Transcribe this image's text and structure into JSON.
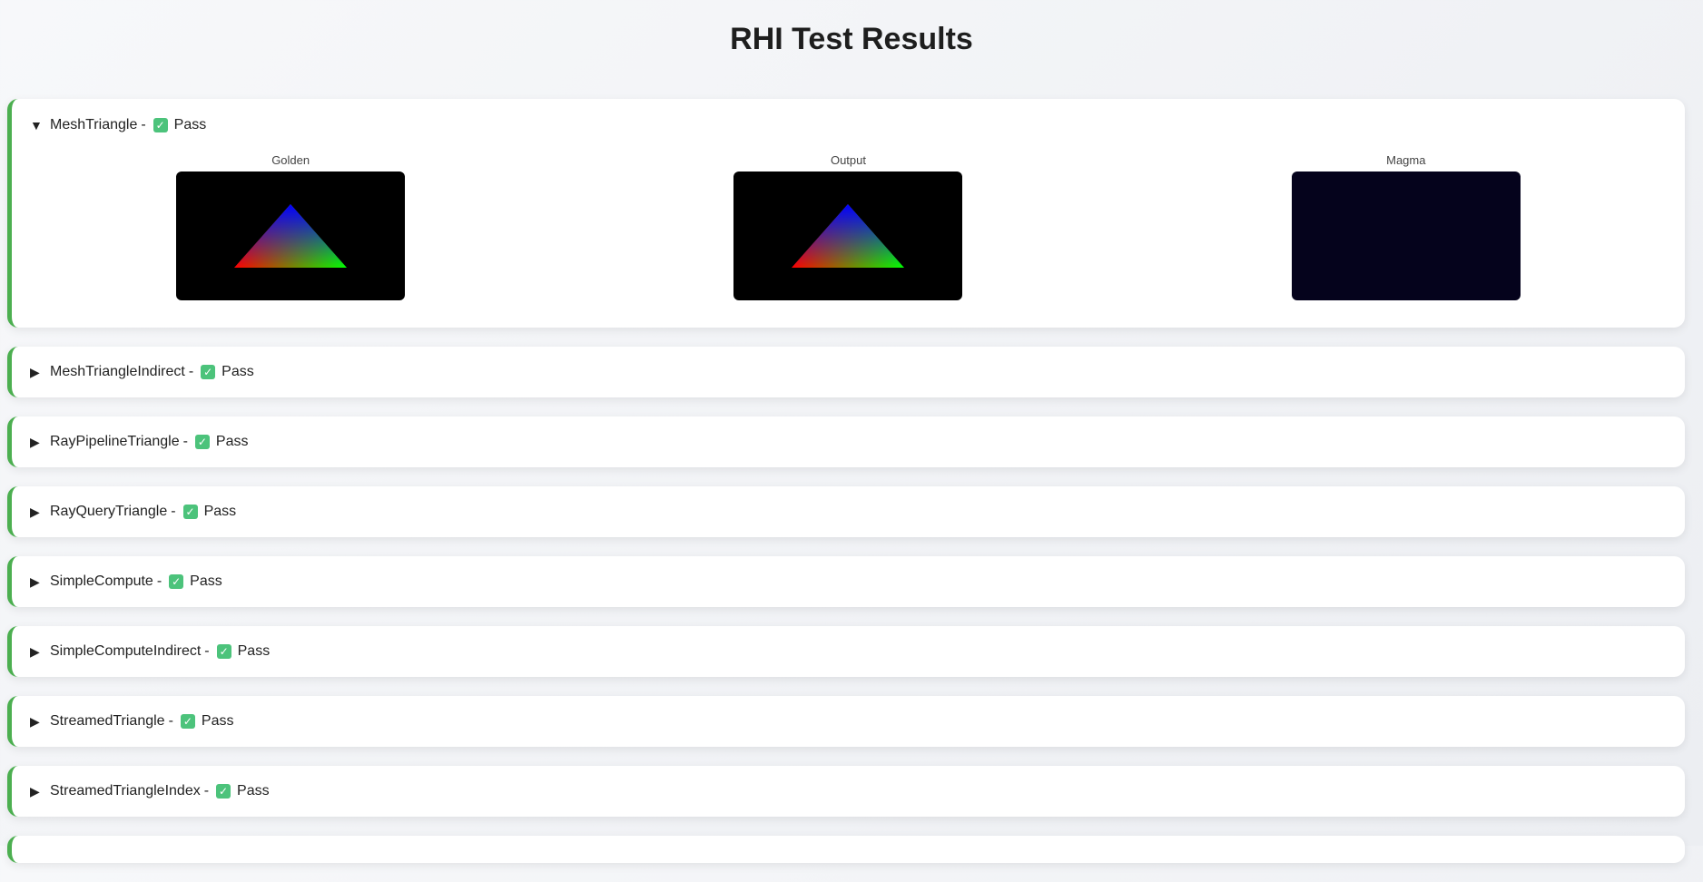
{
  "page": {
    "title": "RHI Test Results"
  },
  "colors": {
    "pass_accent": "#4caf50",
    "check_bg": "#4cc37b",
    "magma_bg": "#05031c"
  },
  "tests": [
    {
      "name": "MeshTriangle",
      "separator": "-",
      "status": "Pass",
      "expanded": true,
      "panels": [
        {
          "label": "Golden"
        },
        {
          "label": "Output"
        },
        {
          "label": "Magma"
        }
      ]
    },
    {
      "name": "MeshTriangleIndirect",
      "separator": "-",
      "status": "Pass",
      "expanded": false
    },
    {
      "name": "RayPipelineTriangle",
      "separator": "-",
      "status": "Pass",
      "expanded": false
    },
    {
      "name": "RayQueryTriangle",
      "separator": "-",
      "status": "Pass",
      "expanded": false
    },
    {
      "name": "SimpleCompute",
      "separator": "-",
      "status": "Pass",
      "expanded": false
    },
    {
      "name": "SimpleComputeIndirect",
      "separator": "-",
      "status": "Pass",
      "expanded": false
    },
    {
      "name": "StreamedTriangle",
      "separator": "-",
      "status": "Pass",
      "expanded": false
    },
    {
      "name": "StreamedTriangleIndex",
      "separator": "-",
      "status": "Pass",
      "expanded": false
    }
  ]
}
